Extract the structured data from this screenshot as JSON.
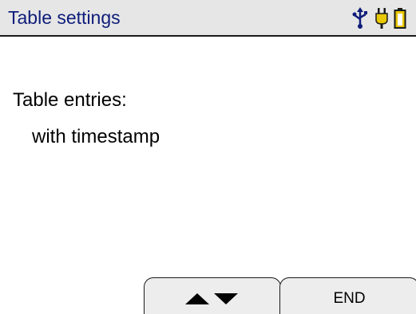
{
  "header": {
    "title": "Table settings",
    "icons": [
      "usb-icon",
      "plug-icon",
      "battery-icon"
    ],
    "title_color": "#0f1d7a",
    "icon_color_usb": "#0f1d7a",
    "icon_color_plug": "#e8c800",
    "icon_color_battery": "#e8c800"
  },
  "main": {
    "setting_label": "Table entries:",
    "setting_value": "with timestamp"
  },
  "softkeys": {
    "left_icons": [
      "arrow-up-icon",
      "arrow-down-icon"
    ],
    "right_label": "END"
  }
}
